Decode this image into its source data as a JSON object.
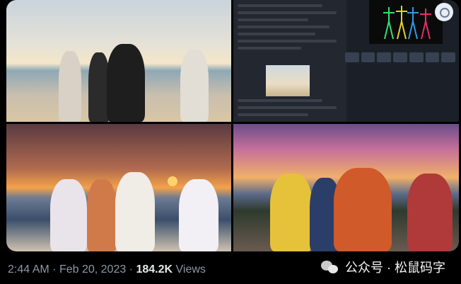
{
  "post": {
    "time": "2:44 AM",
    "separator1": "·",
    "date": "Feb 20, 2023",
    "separator2": "·",
    "views_count": "184.2K",
    "views_label": "Views"
  },
  "watermark": {
    "text": "公众号 · 松鼠码字"
  },
  "images": [
    {
      "name": "original-beach-photo"
    },
    {
      "name": "stable-diffusion-controlnet-ui"
    },
    {
      "name": "anime-sunset-beach-1"
    },
    {
      "name": "anime-sunset-beach-2"
    }
  ],
  "colors": {
    "background": "#000000",
    "text_primary": "#e7e9ea",
    "text_secondary": "#8b98a5"
  }
}
